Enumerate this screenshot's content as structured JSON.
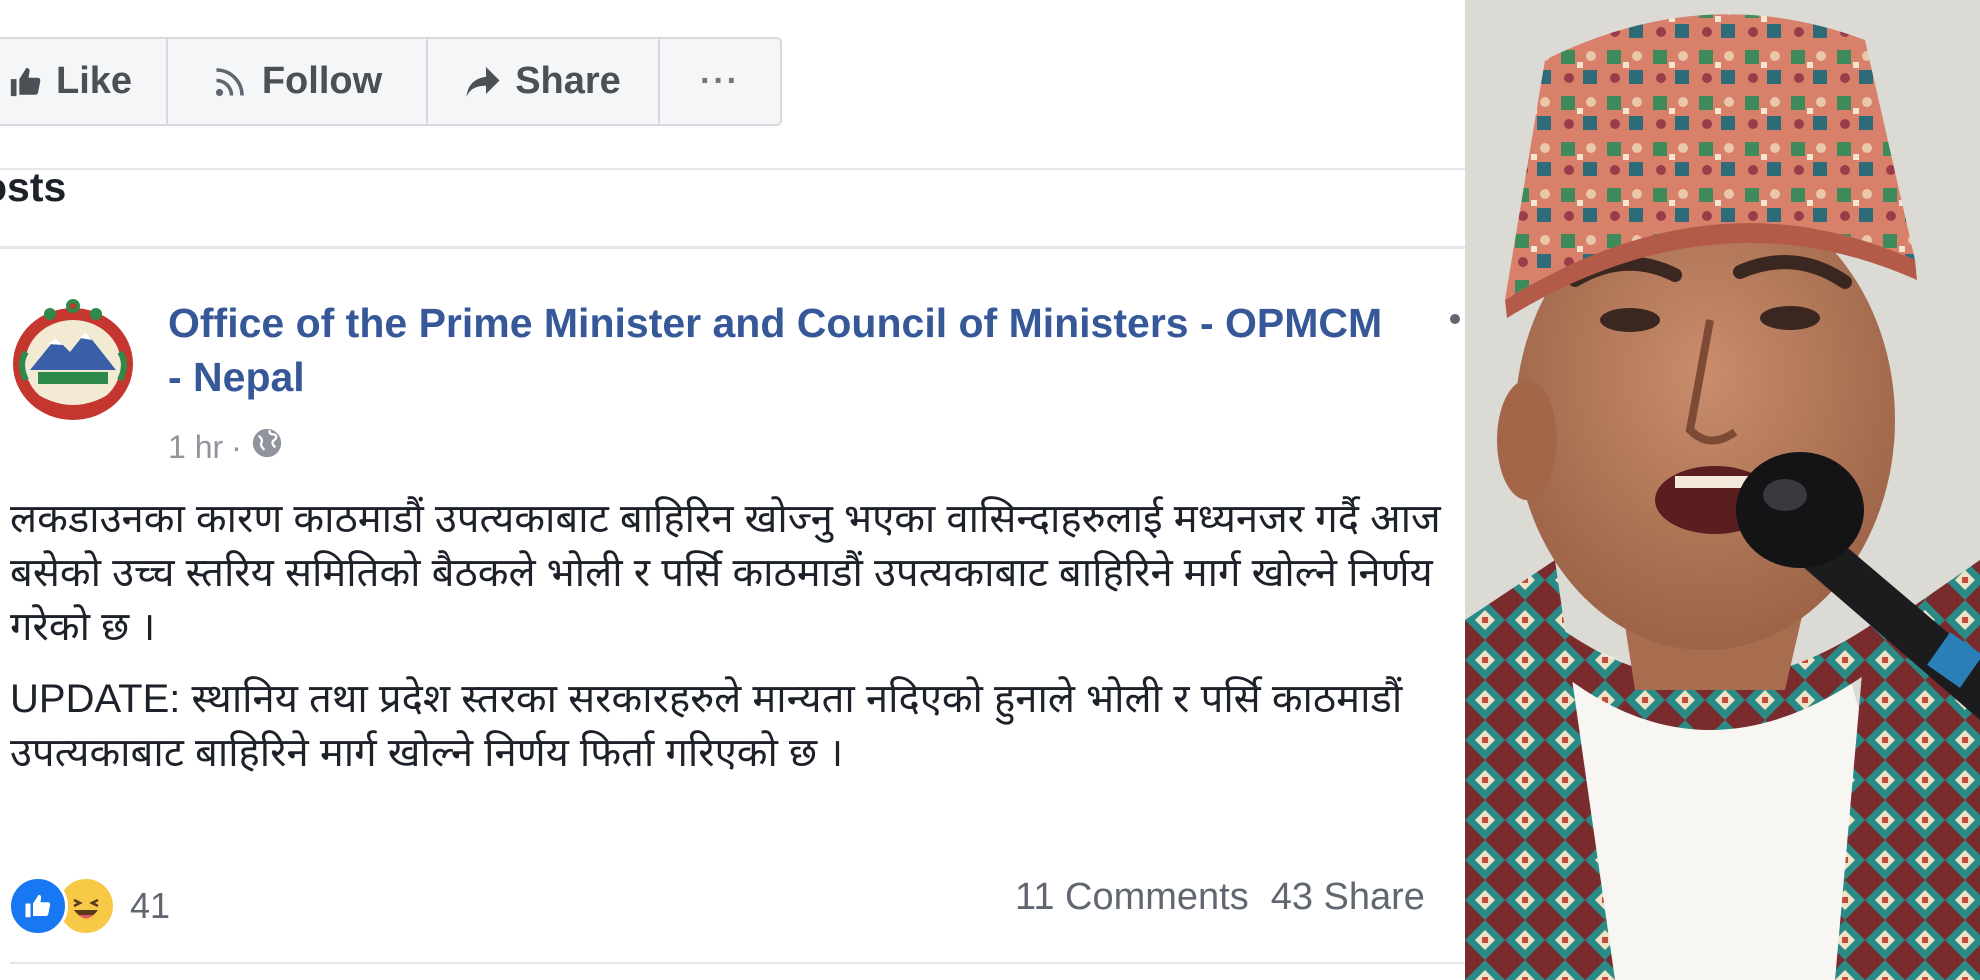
{
  "actions": {
    "like": "Like",
    "follow": "Follow",
    "share": "Share",
    "more": "···"
  },
  "section_title": "osts",
  "post": {
    "page_name": "Office of the Prime Minister and Council of Ministers - OPMCM - Nepal",
    "time": "1 hr",
    "meta_separator": "·",
    "paragraph1": "लकडाउनका कारण काठमाडौं उपत्यकाबाट बाहिरिन खोज्नु भएका वासिन्दाहरुलाई मध्यनजर गर्दै आज बसेको उच्च स्तरिय समितिको बैठकले भोली र पर्सि काठमाडौं उपत्यकाबाट बाहिरिने मार्ग खोल्ने निर्णय गरेको छ ।",
    "paragraph2": "UPDATE: स्थानिय तथा प्रदेश स्तरका सरकारहरुले मान्यता नदिएको हुनाले भोली र पर्सि काठमाडौं उपत्यकाबाट बाहिरिने मार्ग खोल्ने निर्णय फिर्ता गरिएको छ ।",
    "reaction_count": "41",
    "comments": "11 Comments",
    "shares": "43 Share"
  },
  "colors": {
    "link": "#365899",
    "reaction_like": "#1877f2",
    "reaction_haha": "#f7c947"
  },
  "icons": [
    "thumbs-up-icon",
    "rss-icon",
    "share-arrow-icon",
    "more-dots-icon",
    "globe-icon",
    "like-reaction-icon",
    "haha-reaction-icon"
  ]
}
